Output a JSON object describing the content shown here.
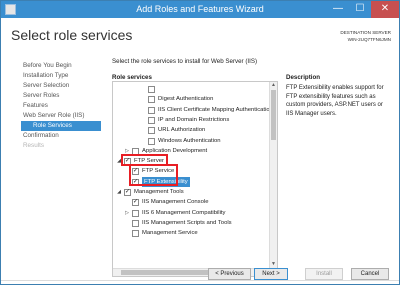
{
  "window": {
    "title": "Add Roles and Features Wizard",
    "controls": {
      "minimize": "—",
      "maximize": "☐",
      "close": "✕"
    }
  },
  "header": {
    "page_title": "Select role services",
    "destination_label": "DESTINATION SERVER",
    "destination_server": "WIN-2UQ7TFN6JMN"
  },
  "nav": {
    "items": [
      {
        "label": "Before You Begin",
        "state": "normal"
      },
      {
        "label": "Installation Type",
        "state": "normal"
      },
      {
        "label": "Server Selection",
        "state": "normal"
      },
      {
        "label": "Server Roles",
        "state": "normal"
      },
      {
        "label": "Features",
        "state": "normal"
      },
      {
        "label": "Web Server Role (IIS)",
        "state": "normal"
      },
      {
        "label": "Role Services",
        "state": "active"
      },
      {
        "label": "Confirmation",
        "state": "normal"
      },
      {
        "label": "Results",
        "state": "disabled"
      }
    ]
  },
  "main": {
    "intro": "Select the role services to install for Web Server (IIS)",
    "role_services_label": "Role services",
    "description_label": "Description",
    "description": "FTP Extensibility enables support for FTP extensibility features such as custom providers, ASP.NET users or IIS Manager users."
  },
  "tree": {
    "rows": [
      {
        "label": "",
        "level": 3,
        "checked": false,
        "expander": ""
      },
      {
        "label": "Digest Authentication",
        "level": 3,
        "checked": false,
        "expander": ""
      },
      {
        "label": "IIS Client Certificate Mapping Authenticatio",
        "level": 3,
        "checked": false,
        "expander": ""
      },
      {
        "label": "IP and Domain Restrictions",
        "level": 3,
        "checked": false,
        "expander": ""
      },
      {
        "label": "URL Authorization",
        "level": 3,
        "checked": false,
        "expander": ""
      },
      {
        "label": "Windows Authentication",
        "level": 3,
        "checked": false,
        "expander": ""
      },
      {
        "label": "Application Development",
        "level": 1,
        "checked": false,
        "expander": "▷"
      },
      {
        "label": "FTP Server",
        "level": 0,
        "checked": true,
        "expander": "◢"
      },
      {
        "label": "FTP Service",
        "level": 1,
        "checked": true,
        "expander": ""
      },
      {
        "label": "FTP Extensibility",
        "level": 1,
        "checked": true,
        "expander": "",
        "selected": true
      },
      {
        "label": "Management Tools",
        "level": 0,
        "checked": true,
        "expander": "◢"
      },
      {
        "label": "IIS Management Console",
        "level": 1,
        "checked": true,
        "expander": ""
      },
      {
        "label": "IIS 6 Management Compatibility",
        "level": 1,
        "checked": false,
        "expander": "▷"
      },
      {
        "label": "IIS Management Scripts and Tools",
        "level": 1,
        "checked": false,
        "expander": ""
      },
      {
        "label": "Management Service",
        "level": 1,
        "checked": false,
        "expander": ""
      }
    ]
  },
  "buttons": {
    "previous": "< Previous",
    "next": "Next >",
    "install": "Install",
    "cancel": "Cancel"
  },
  "colors": {
    "accent": "#3a8fd0",
    "highlight_border": "#e81e24"
  }
}
